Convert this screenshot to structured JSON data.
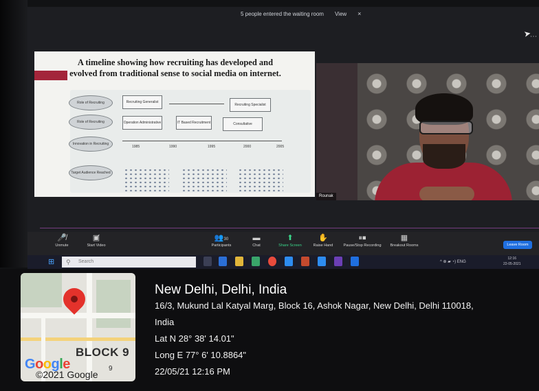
{
  "notice": {
    "text": "5 people entered the waiting room",
    "view": "View",
    "close": "×"
  },
  "slide": {
    "title_line1": "A timeline showing how recruiting has developed and",
    "title_line2": "evolved from traditional sense to social media on internet.",
    "row_labels": [
      "Role of Recruiting",
      "Role of Recruiting",
      "Innovation in Recruiting",
      "Target Audience Reached"
    ],
    "boxes": [
      "Recruiting Generalist",
      "Recruiting Specialist",
      "Operation Administrative",
      "IT Based Recruitment",
      "Consultative"
    ],
    "years": [
      "1985",
      "1990",
      "1995",
      "2000",
      "2005"
    ]
  },
  "video": {
    "name": "Rounak"
  },
  "toolbar": {
    "unmute": "Unmute",
    "start_video": "Start Video",
    "participants": "Participants",
    "participants_count": "30",
    "chat": "Chat",
    "share_screen": "Share Screen",
    "raise_hand": "Raise Hand",
    "record": "Pause/Stop Recording",
    "breakout": "Breakout Rooms",
    "leave": "Leave Room"
  },
  "taskbar": {
    "search_placeholder": "Search",
    "lang": "ENG",
    "time": "12:16",
    "date": "22-05-2021"
  },
  "map": {
    "block_label": "BLOCK 9",
    "block_number": "9",
    "brand": "Google",
    "copyright": "©2021 Google"
  },
  "geotag": {
    "title": "New Delhi, Delhi, India",
    "address_line1": "16/3, Mukund Lal Katyal Marg, Block 16, Ashok Nagar, New Delhi, Delhi 110018,",
    "address_line2": "India",
    "lat": "Lat N 28° 38' 14.01\"",
    "long": "Long E 77° 6' 10.8864\"",
    "datetime": "22/05/21 12:16 PM"
  },
  "colors": {
    "leave_button": "#1f6fe0",
    "pin": "#e3322b",
    "shirt": "#9c2233",
    "slide_band": "#a3253a"
  },
  "icons": [
    "mic-muted-icon",
    "video-off-icon",
    "participants-icon",
    "chat-icon",
    "share-screen-icon",
    "raise-hand-icon",
    "record-icon",
    "breakout-icon",
    "windows-start-icon",
    "search-icon",
    "map-pin-icon"
  ]
}
